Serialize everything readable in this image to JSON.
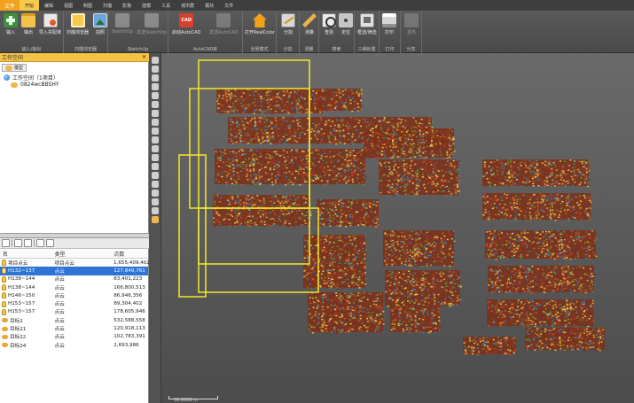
{
  "app_menu": {
    "label": "文件"
  },
  "tabs": [
    {
      "label": "开始",
      "active": true
    },
    {
      "label": "编辑"
    },
    {
      "label": "视图"
    },
    {
      "label": "制图"
    },
    {
      "label": "扫描"
    },
    {
      "label": "影像"
    },
    {
      "label": "建模"
    },
    {
      "label": "工具"
    },
    {
      "label": "城市群"
    },
    {
      "label": "模块"
    },
    {
      "label": "文件"
    }
  ],
  "ribbon": {
    "groups": [
      {
        "label": "输入/输出"
      },
      {
        "label": "扫描浏览器"
      },
      {
        "label": "SketchUp"
      },
      {
        "label": "AutoCAD库"
      },
      {
        "label": "全景模式"
      },
      {
        "label": "分割"
      },
      {
        "label": "测量"
      },
      {
        "label": "搜索"
      },
      {
        "label": "三维处理"
      },
      {
        "label": "打印"
      },
      {
        "label": "分享"
      }
    ],
    "buttons": {
      "input": "输入",
      "output": "输出",
      "import_cfg": "导入并配准",
      "scan_browser": "扫描浏览器",
      "photo": "拍照",
      "sketchup": "SketchUp",
      "send_sketchup": "发送SketchUp",
      "open_autocad": "启动AutoCAD",
      "send_autocad": "发送AutoCAD",
      "realcolor": "打开RealColor",
      "clip": "分割",
      "measure": "测量",
      "find": "查找",
      "locate": "定位",
      "region_select": "框选/筛选",
      "print": "打印",
      "publish": "发布"
    }
  },
  "workspace": {
    "title": "工作空间",
    "tab": "模型",
    "root": "工作空间（1项目）",
    "child": "0824wcBBSHY"
  },
  "list": {
    "headers": {
      "name": "名",
      "type": "类型",
      "points": "点数"
    },
    "rows": [
      {
        "name": "项目点云",
        "type": "项目点云",
        "points": "1,655,409,402",
        "icon": "bulb-icon"
      },
      {
        "name": "H132~137",
        "type": "点云",
        "points": "127,849,761",
        "icon": "bulb-icon",
        "selected": true
      },
      {
        "name": "H138~144",
        "type": "点云",
        "points": "83,401,223",
        "icon": "bulb-icon"
      },
      {
        "name": "H138~144",
        "type": "点云",
        "points": "166,800,513",
        "icon": "bulb-icon"
      },
      {
        "name": "H146~150",
        "type": "点云",
        "points": "86,946,356",
        "icon": "bulb-icon"
      },
      {
        "name": "H153~157",
        "type": "点云",
        "points": "89,304,402",
        "icon": "bulb-icon"
      },
      {
        "name": "H153~157",
        "type": "点云",
        "points": "178,605,946",
        "icon": "bulb-icon"
      },
      {
        "name": "目标2",
        "type": "点云",
        "points": "532,588,558",
        "icon": "cloud-icon"
      },
      {
        "name": "目标21",
        "type": "点云",
        "points": "120,918,113",
        "icon": "cloud-icon"
      },
      {
        "name": "目标22",
        "type": "点云",
        "points": "102,783,391",
        "icon": "cloud-icon"
      },
      {
        "name": "目标24",
        "type": "点云",
        "points": "2,693,986",
        "icon": "cloud-icon"
      }
    ]
  },
  "viewport": {
    "scale_label": "50.0000 m"
  }
}
